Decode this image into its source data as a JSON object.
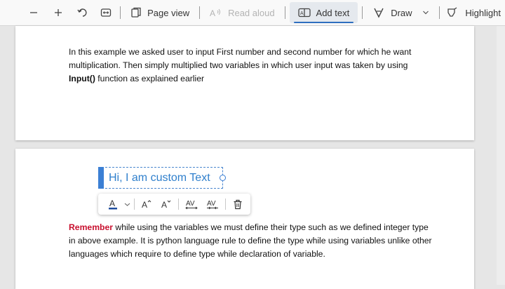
{
  "toolbar": {
    "page_view_label": "Page view",
    "read_aloud_label": "Read aloud",
    "add_text_label": "Add text",
    "draw_label": "Draw",
    "highlight_label": "Highlight"
  },
  "page1": {
    "paragraph": {
      "text_before": "In this example we asked user to input First number and second number for which he want multiplication. Then simply multiplied two variables in which user input was taken by using ",
      "bold": "Input()",
      "text_after": " function as explained earlier"
    }
  },
  "page2": {
    "textbox": {
      "text": "Hi, I am custom Text"
    },
    "paragraph": {
      "highlight": "Remember",
      "text": " while using the variables we must define their type such as we defined integer type in above example. It is python language rule to define the type while using variables unlike other languages which require to define type while declaration of variable."
    }
  },
  "colors": {
    "accent": "#2f6fbf",
    "textbox_text": "#2f7fcc",
    "remember_red": "#c8102e"
  }
}
